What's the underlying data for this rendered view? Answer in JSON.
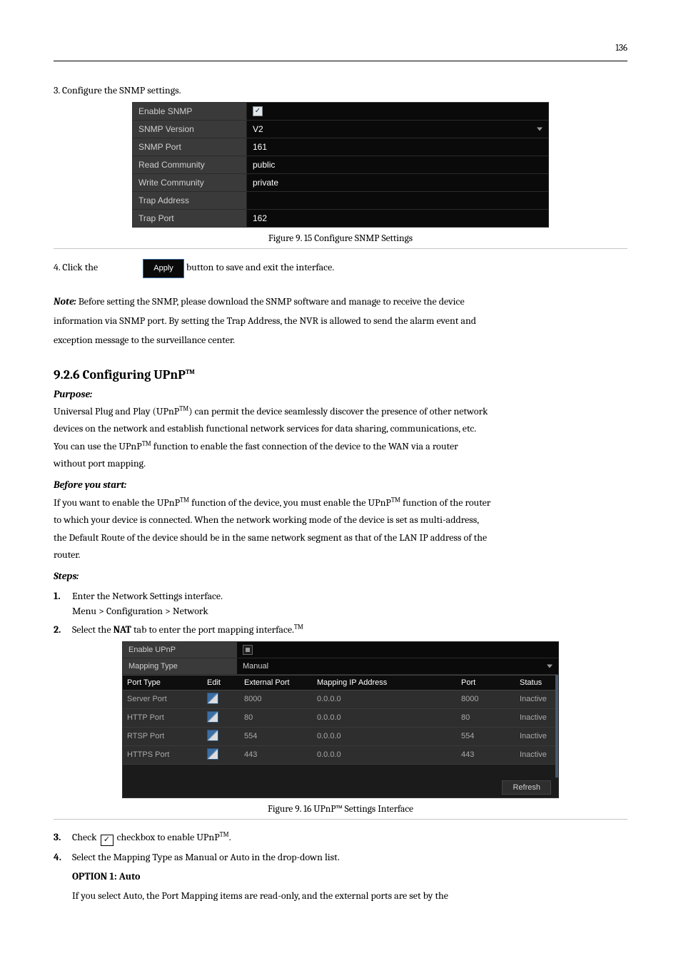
{
  "page_number": "136",
  "pre_text": "3.   Configure the SNMP settings.",
  "snmp": {
    "rows": [
      {
        "label": "Enable SNMP",
        "value": "",
        "type": "check",
        "checked": true
      },
      {
        "label": "SNMP Version",
        "value": "V2",
        "type": "dropdown"
      },
      {
        "label": "SNMP Port",
        "value": "161",
        "type": "text"
      },
      {
        "label": "Read Community",
        "value": "public",
        "type": "text"
      },
      {
        "label": "Write Community",
        "value": "private",
        "type": "text"
      },
      {
        "label": "Trap Address",
        "value": "",
        "type": "text"
      },
      {
        "label": "Trap Port",
        "value": "162",
        "type": "text"
      }
    ]
  },
  "snmp_caption": "Figure 9. 15  Configure SNMP Settings",
  "step4_line1": "4.   Click the ",
  "apply_label": "Apply",
  "step4_line2": " button to save and exit the interface.",
  "note_line1a": "Note: ",
  "note_line1b": "Before setting the SNMP, please download the SNMP software and manage to receive the device",
  "note_line2": "information via SNMP port. By setting the Trap Address, the NVR is allowed to send the alarm event and",
  "note_line3": "exception message to the surveillance center.",
  "h2": "9.2.6  Configuring UPnP",
  "h2_tm": "TM",
  "purpose_head": "Purpose:",
  "purpose_l1a": "Universal Plug and Play (UPnP",
  "purpose_l1b": ") can permit the device seamlessly discover the presence of other network",
  "purpose_l2": "devices on the network and establish functional network services for data sharing, communications, etc.",
  "purpose_l3a": "You can use the UPnP",
  "purpose_l3b": " function to enable the fast connection of the device to the WAN via a router",
  "purpose_l4": "without port mapping.",
  "before_head": "Before you start:",
  "before_l1a": "If you want to enable the UPnP",
  "before_l1b": " function of the device, you must enable the UPnP",
  "before_l1c": " function of the router",
  "before_l2": "to which your device is connected. When the network working mode of the device is set as multi-address,",
  "before_l3": "the Default Route of the device should be in the same network segment as that of the LAN IP address of the",
  "before_l4": "router.",
  "steps_head": "Steps:",
  "step1_a": "Enter the Network Settings interface.",
  "step1_b": "Menu > Configuration > Network",
  "step2_a": "Select the ",
  "step2_b": "NAT",
  "step2_c": " tab to enter the port mapping interface.",
  "upnp": {
    "enable_label": "Enable UPnP",
    "mapping_type_label": "Mapping Type",
    "mapping_type_value": "Manual",
    "columns": [
      "Port Type",
      "Edit",
      "External Port",
      "Mapping IP Address",
      "Port",
      "Status"
    ],
    "rows": [
      {
        "type": "Server Port",
        "ext": "8000",
        "ip": "0.0.0.0",
        "port": "8000",
        "status": "Inactive"
      },
      {
        "type": "HTTP Port",
        "ext": "80",
        "ip": "0.0.0.0",
        "port": "80",
        "status": "Inactive"
      },
      {
        "type": "RTSP Port",
        "ext": "554",
        "ip": "0.0.0.0",
        "port": "554",
        "status": "Inactive"
      },
      {
        "type": "HTTPS Port",
        "ext": "443",
        "ip": "0.0.0.0",
        "port": "443",
        "status": "Inactive"
      }
    ],
    "refresh": "Refresh"
  },
  "upnp_caption": "Figure 9. 16  UPnP™ Settings Interface",
  "step3_a": "Check ",
  "step3_b": " checkbox to enable UPnP",
  "step3_c": ".",
  "step4b_a": "Select the Mapping Type as Manual or Auto in the drop-down list.",
  "opt1_head": "OPTION 1: Auto",
  "opt1_body": "If you select Auto, the Port Mapping items are read-only, and the external ports are set by the"
}
